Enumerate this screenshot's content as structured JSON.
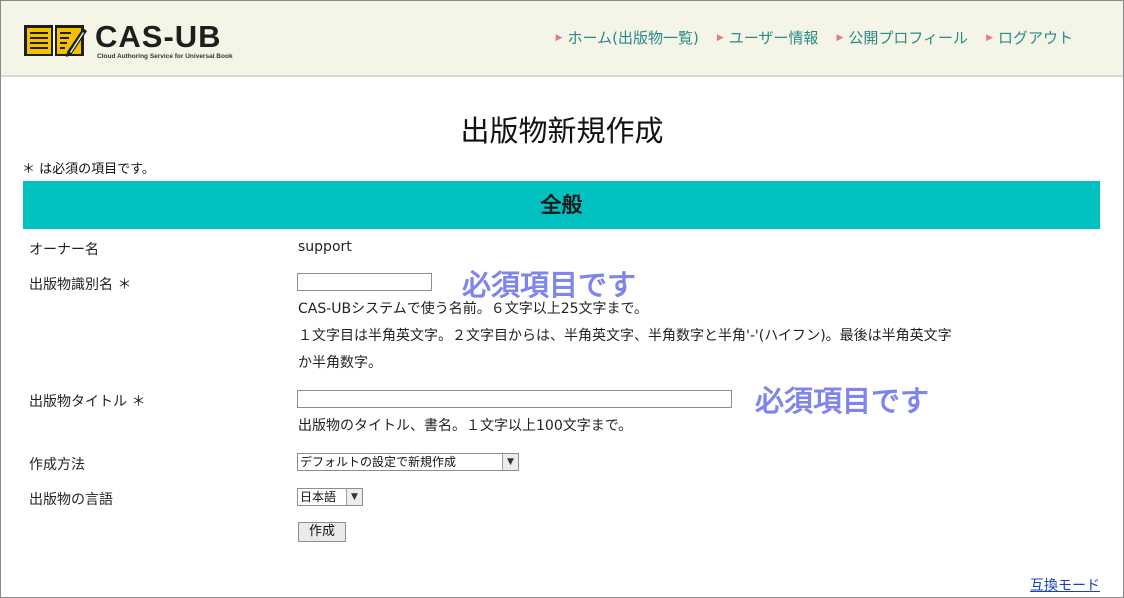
{
  "header": {
    "logo": {
      "name": "CAS-UB",
      "tagline": "Cloud Authoring Service for Universal Book"
    },
    "nav": [
      {
        "label": "ホーム(出版物一覧)"
      },
      {
        "label": "ユーザー情報"
      },
      {
        "label": "公開プロフィール"
      },
      {
        "label": "ログアウト"
      }
    ]
  },
  "page": {
    "title": "出版物新規作成",
    "required_note": "＊ は必須の項目です。"
  },
  "section": {
    "title": "全般"
  },
  "form": {
    "owner": {
      "label": "オーナー名",
      "value": "support"
    },
    "identifier": {
      "label": "出版物識別名 ＊",
      "value": "",
      "help": [
        "CAS-UBシステムで使う名前。６文字以上25文字まで。",
        "１文字目は半角英文字。２文字目からは、半角英文字、半角数字と半角'-'(ハイフン)。最後は半角英文字",
        "か半角数字。"
      ]
    },
    "title": {
      "label": "出版物タイトル ＊",
      "value": "",
      "help": "出版物のタイトル、書名。１文字以上100文字まで。"
    },
    "method": {
      "label": "作成方法",
      "selected": "デフォルトの設定で新規作成"
    },
    "language": {
      "label": "出版物の言語",
      "selected": "日本語"
    },
    "submit_label": "作成"
  },
  "annotations": {
    "identifier_required": "必須項目です",
    "title_required": "必須項目です"
  },
  "footer": {
    "compat_link": "互換モード"
  },
  "colors": {
    "header_bg": "#f4f5e6",
    "nav_text": "#2a8a8a",
    "nav_arrow": "#e07a96",
    "section_bar": "#00c0c0",
    "annotation": "#7f85ec",
    "link": "#1a3fbf"
  },
  "icons": {
    "logo": "open-book-pencil-icon",
    "nav_bullet": "triangle-right-icon",
    "dropdown": "chevron-down-icon"
  }
}
